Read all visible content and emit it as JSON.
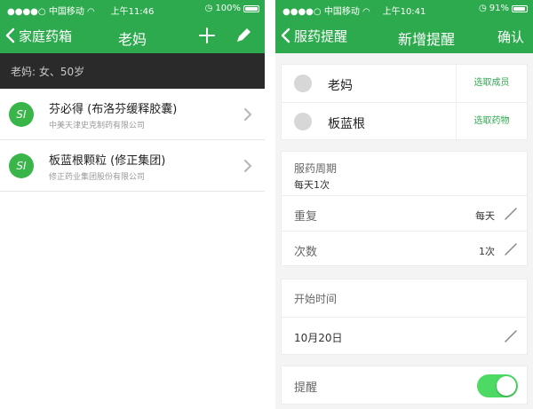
{
  "screen1": {
    "status": {
      "carrier": "中国移动",
      "time": "上午11:46",
      "battery": "100%"
    },
    "nav": {
      "back_label": "家庭药箱",
      "title": "老妈",
      "add_icon": "plus-icon",
      "edit_icon": "pencil-icon"
    },
    "member_info": "老妈:  女、50岁",
    "drugs": [
      {
        "logo": "SI",
        "name": "芬必得 (布洛芬缓释胶囊)",
        "maker": "中美天津史克制药有限公司"
      },
      {
        "logo": "SI",
        "name": "板蓝根颗粒 (修正集团)",
        "maker": "修正药业集团股份有限公司"
      }
    ]
  },
  "screen2": {
    "status": {
      "carrier": "中国移动",
      "time": "上午10:41",
      "battery": "91%"
    },
    "nav": {
      "back_label": "服药提醒",
      "title": "新增提醒",
      "confirm_label": "确认"
    },
    "selection": {
      "member": {
        "name": "老妈",
        "action": "选取成员"
      },
      "medicine": {
        "name": "板蓝根",
        "action": "选取药物"
      }
    },
    "schedule": {
      "cycle_label": "服药周期",
      "cycle_value": "每天1次",
      "repeat_label": "重复",
      "repeat_value": "每天",
      "times_label": "次数",
      "times_value": "1次"
    },
    "start": {
      "label": "开始时间",
      "value": "10月20日"
    },
    "reminder": {
      "label": "提醒",
      "enabled": true
    }
  },
  "colors": {
    "brand_green": "#2eaa4e",
    "toggle_on": "#4cd964",
    "member_bar": "#2a2a2a"
  }
}
